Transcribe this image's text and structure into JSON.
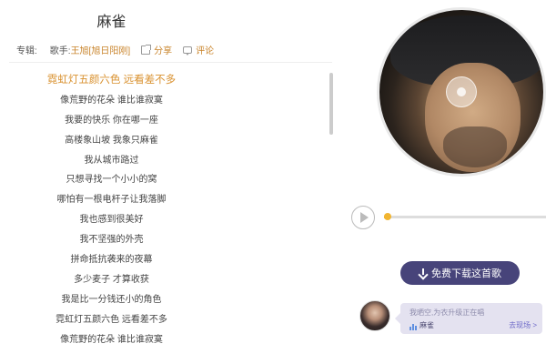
{
  "song": {
    "title": "麻雀"
  },
  "meta": {
    "album_label": "专辑:",
    "singer_label": "歌手:",
    "singer": "王旭[旭日阳刚]",
    "share_label": "分享",
    "comment_label": "评论"
  },
  "lyrics": {
    "lines": [
      "霓虹灯五颜六色 远看差不多",
      "像荒野的花朵 谁比谁寂寞",
      "我要的快乐 你在哪一座",
      "高楼象山坡 我象只麻雀",
      "我从城市路过",
      "只想寻找一个小小的窝",
      "哪怕有一根电杆子让我落脚",
      "我也感到很美好",
      "我不坚强的外壳",
      "拼命抵抗袭来的夜幕",
      "多少麦子 才算收获",
      "我是比一分钱还小的角色",
      "霓虹灯五颜六色 远看差不多",
      "像荒野的花朵 谁比谁寂寞"
    ],
    "active_index": 0
  },
  "player": {
    "progress": 0.01
  },
  "download": {
    "label": "免费下载这首歌"
  },
  "live": {
    "text": "我晒空,为衣升级正在唱",
    "song": "麻雀",
    "link": "去现场 >"
  },
  "colors": {
    "accent": "#d9912f",
    "progress": "#f1b531",
    "download_bg": "#47447a",
    "live_card_bg": "#e4e2f0"
  },
  "icons": [
    "share-icon",
    "comment-icon",
    "play-icon",
    "download-icon",
    "bars-icon",
    "disc-icon"
  ]
}
